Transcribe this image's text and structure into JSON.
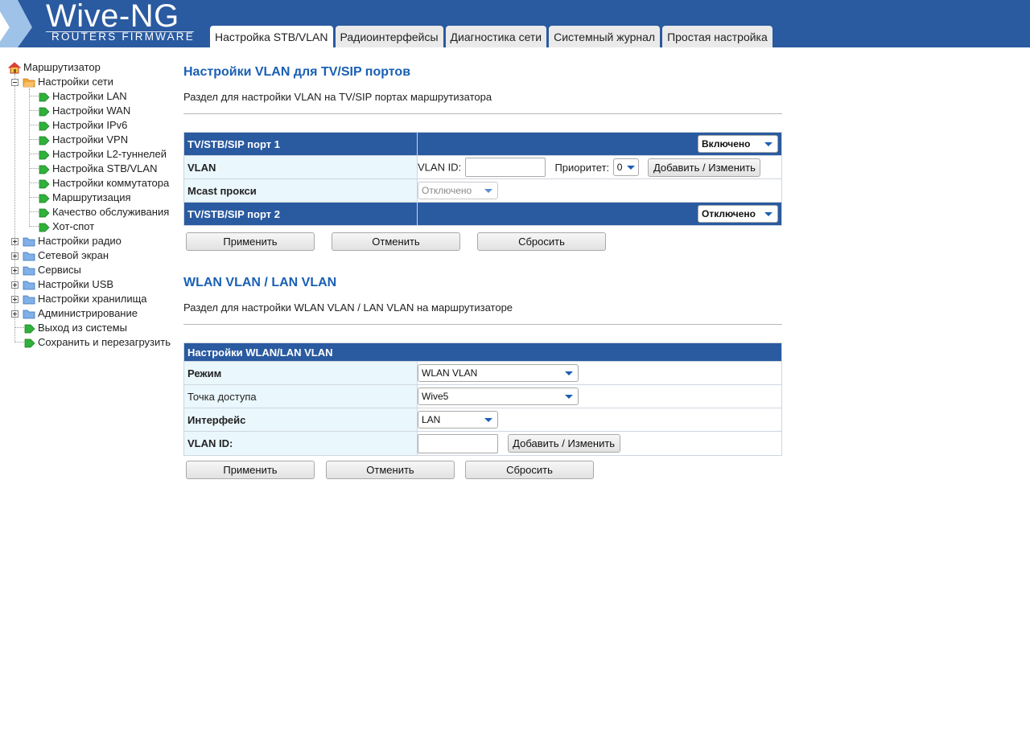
{
  "colors": {
    "header_bg": "#2a5aa0",
    "title_blue": "#1a5fb4",
    "label_bg": "#eaf7fd"
  },
  "logo": {
    "title": "Wive-NG",
    "subtitle": "ROUTERS FIRMWARE"
  },
  "tabs": [
    {
      "label": "Настройка STB/VLAN",
      "active": true
    },
    {
      "label": "Радиоинтерфейсы"
    },
    {
      "label": "Диагностика сети"
    },
    {
      "label": "Системный журнал"
    },
    {
      "label": "Простая настройка"
    }
  ],
  "tree": {
    "root": "Маршрутизатор",
    "network": "Настройки сети",
    "network_items": [
      "Настройки LAN",
      "Настройки WAN",
      "Настройки IPv6",
      "Настройки VPN",
      "Настройки L2-туннелей",
      "Настройка STB/VLAN",
      "Настройки коммутатора",
      "Маршрутизация",
      "Качество обслуживания",
      "Хот-спот"
    ],
    "folders": [
      "Настройки радио",
      "Сетевой экран",
      "Сервисы",
      "Настройки USB",
      "Настройки хранилища",
      "Администрирование"
    ],
    "logout": "Выход из системы",
    "save_reboot": "Сохранить и перезагрузить"
  },
  "section1": {
    "title": "Настройки VLAN для TV/SIP портов",
    "desc": "Раздел для настройки VLAN на TV/SIP портах маршрутизатора",
    "port1_label": "TV/STB/SIP порт 1",
    "port1_value": "Включено",
    "vlan_label": "VLAN",
    "vlan_id_label": "VLAN ID:",
    "vlan_id_value": "",
    "priority_label": "Приоритет:",
    "priority_value": "0",
    "add_button": "Добавить / Изменить",
    "mcast_label": "Mcast прокси",
    "mcast_value": "Отключено",
    "port2_label": "TV/STB/SIP порт 2",
    "port2_value": "Отключено",
    "apply": "Применить",
    "cancel": "Отменить",
    "reset": "Сбросить"
  },
  "section2": {
    "title": "WLAN VLAN / LAN VLAN",
    "desc": "Раздел для настройки WLAN VLAN / LAN VLAN на маршрутизаторе",
    "table_head": "Настройки WLAN/LAN VLAN",
    "mode_label": "Режим",
    "mode_value": "WLAN VLAN",
    "ap_label": "Точка доступа",
    "ap_value": "Wive5",
    "iface_label": "Интерфейс",
    "iface_value": "LAN",
    "vlan_id_label": "VLAN ID:",
    "vlan_id_value": "",
    "add_button": "Добавить / Изменить",
    "apply": "Применить",
    "cancel": "Отменить",
    "reset": "Сбросить"
  }
}
